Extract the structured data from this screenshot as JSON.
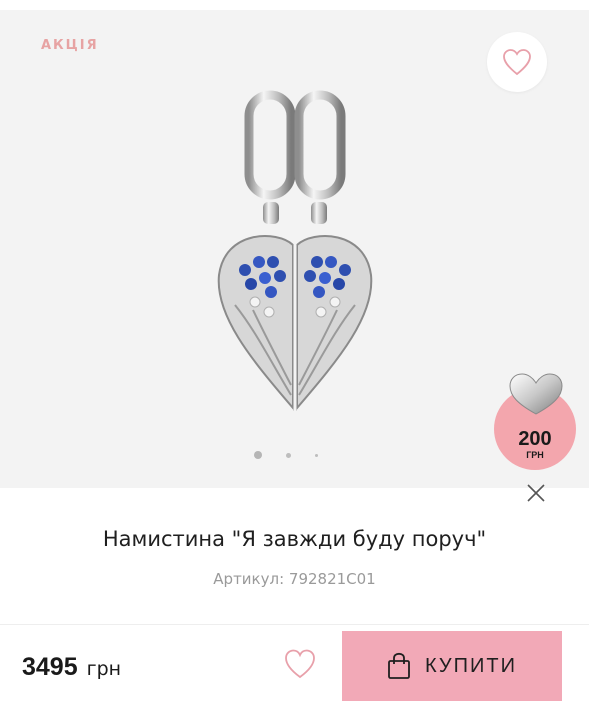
{
  "gallery": {
    "sale_badge": "АКЦІЯ",
    "favorite_icon": "heart-outline-icon",
    "image_icon": "angel-wing-heart-charm",
    "page_indicator": {
      "current": 1,
      "total": 3
    }
  },
  "promo": {
    "price": "200",
    "currency": "ГРН",
    "image_icon": "silver-heart-charm"
  },
  "product": {
    "title": "Намистина \"Я завжди буду поруч\"",
    "sku": "Артикул: 792821C01"
  },
  "bottom_bar": {
    "price": "3495",
    "currency": "грн",
    "buy_label": "КУПИТИ",
    "buy_icon": "shopping-bag-icon"
  },
  "colors": {
    "accent_pink": "#f2a9b7",
    "sale_text": "#e7a3a3",
    "promo_circle": "#f3a6ad"
  }
}
